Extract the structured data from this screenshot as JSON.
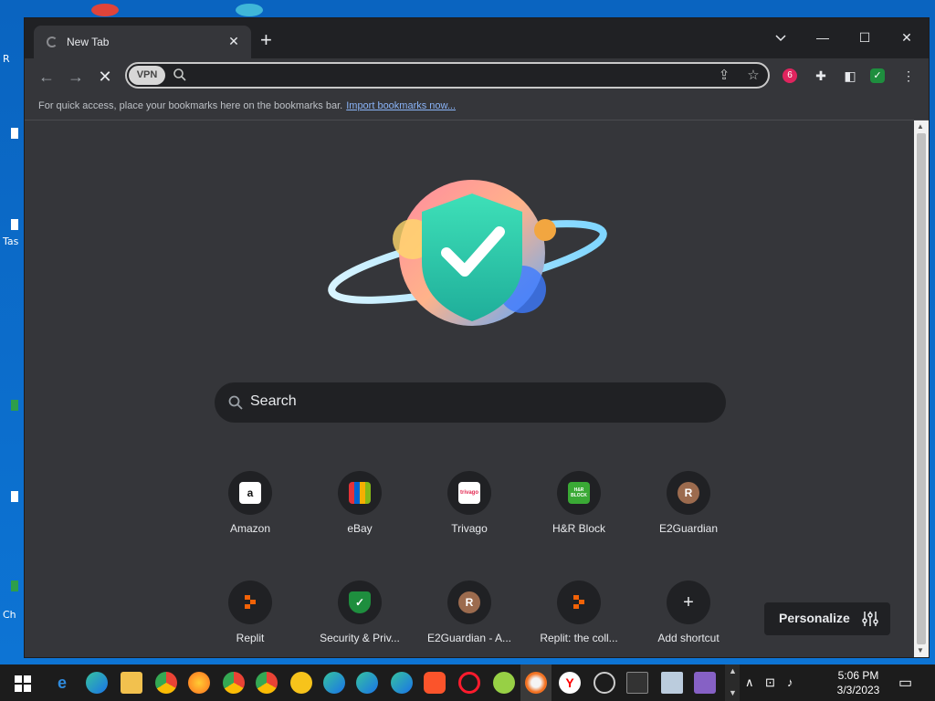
{
  "browser": {
    "tab_title": "New Tab",
    "vpn_label": "VPN",
    "address_value": "",
    "bookmarks_text": "For quick access, place your bookmarks here on the bookmarks bar.",
    "bookmarks_link": "Import bookmarks now..."
  },
  "newtab": {
    "search_placeholder": "Search",
    "shortcuts": [
      {
        "label": "Amazon",
        "icon": "amazon-logo",
        "glyph": "a",
        "color": "#ffffff"
      },
      {
        "label": "eBay",
        "icon": "ebay-logo",
        "glyph": "",
        "color": "#e53238"
      },
      {
        "label": "Trivago",
        "icon": "trivago-logo",
        "glyph": "trivago",
        "color": "#ffffff"
      },
      {
        "label": "H&R Block",
        "icon": "hrblock-logo",
        "glyph": "H&R BLOCK",
        "color": "#3aa935"
      },
      {
        "label": "E2Guardian",
        "icon": "letter-r-avatar",
        "glyph": "R",
        "color": "#9c6b4e"
      },
      {
        "label": "Replit",
        "icon": "replit-logo",
        "glyph": "",
        "color": "#f26207"
      },
      {
        "label": "Security & Priv...",
        "icon": "shield-check-icon",
        "glyph": "✓",
        "color": "#1e8e3e"
      },
      {
        "label": "E2Guardian - A...",
        "icon": "letter-r-avatar",
        "glyph": "R",
        "color": "#9c6b4e"
      },
      {
        "label": "Replit: the coll...",
        "icon": "replit-logo",
        "glyph": "",
        "color": "#f26207"
      },
      {
        "label": "Add shortcut",
        "icon": "plus-icon",
        "glyph": "+",
        "color": "#e8eaed"
      }
    ],
    "personalize_label": "Personalize"
  },
  "taskbar": {
    "time": "5:06 PM",
    "date": "3/3/2023"
  },
  "desktop": {
    "labels": [
      "R",
      "Tas",
      "Ch"
    ]
  }
}
